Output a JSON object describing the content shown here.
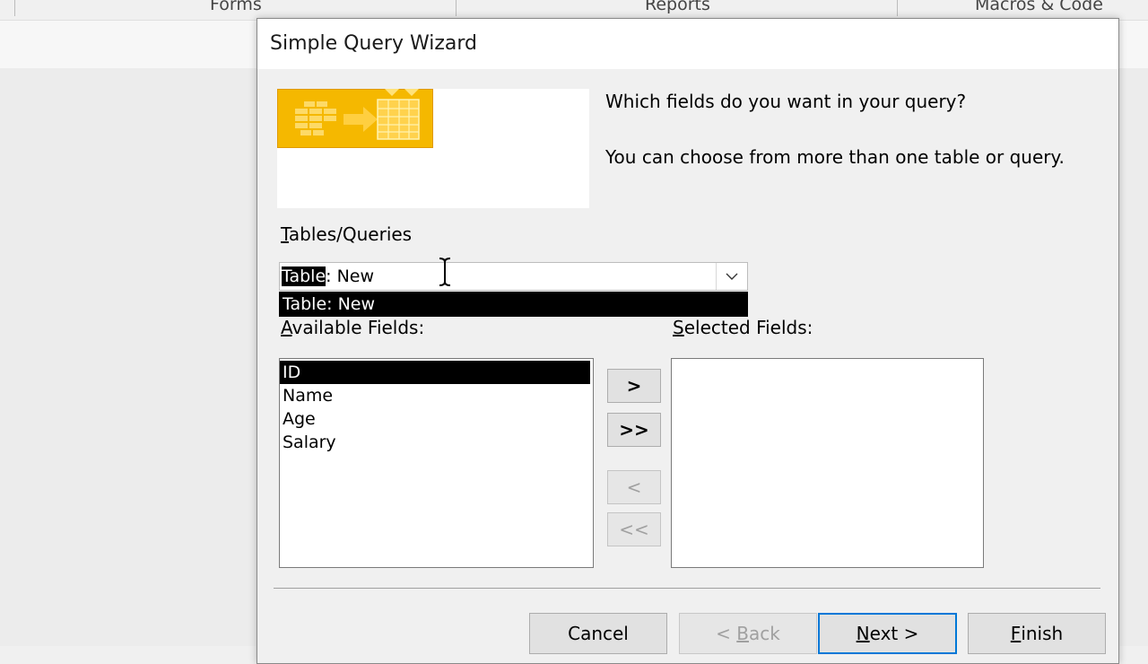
{
  "background": {
    "ribbon_groups": [
      "Forms",
      "Reports",
      "Macros & Code"
    ]
  },
  "dialog": {
    "title": "Simple Query Wizard",
    "prompt_fields": "Which fields do you want in your query?",
    "prompt_choose": "You can choose from more than one table or query.",
    "tables_label_accel": "T",
    "tables_label_rest": "ables/Queries",
    "combo": {
      "value_selected": "Table",
      "value_rest": ": New",
      "dropdown_options": [
        "Table: New"
      ]
    },
    "available_label_accel": "A",
    "available_label_rest": "vailable Fields:",
    "selected_label_accel": "S",
    "selected_label_rest": "elected Fields:",
    "available_fields": [
      "ID",
      "Name",
      "Age",
      "Salary"
    ],
    "selected_available_field": "ID",
    "selected_fields": [],
    "move_buttons": {
      "add_one": ">",
      "add_all": ">>",
      "remove_one": "<",
      "remove_all": "<<"
    },
    "buttons": {
      "cancel": "Cancel",
      "back_prefix": "< ",
      "back_accel": "B",
      "back_rest": "ack",
      "next_accel": "N",
      "next_rest": "ext >",
      "finish_accel": "F",
      "finish_rest": "inish"
    }
  },
  "colors": {
    "selection": "#000000",
    "default_button_border": "#0078d7",
    "wizard_image": "#f5b800"
  },
  "icons": {
    "combo_arrow": "chevron-down-icon",
    "wizard_graphic": "table-to-query-icon",
    "cursor": "text-cursor-icon"
  }
}
